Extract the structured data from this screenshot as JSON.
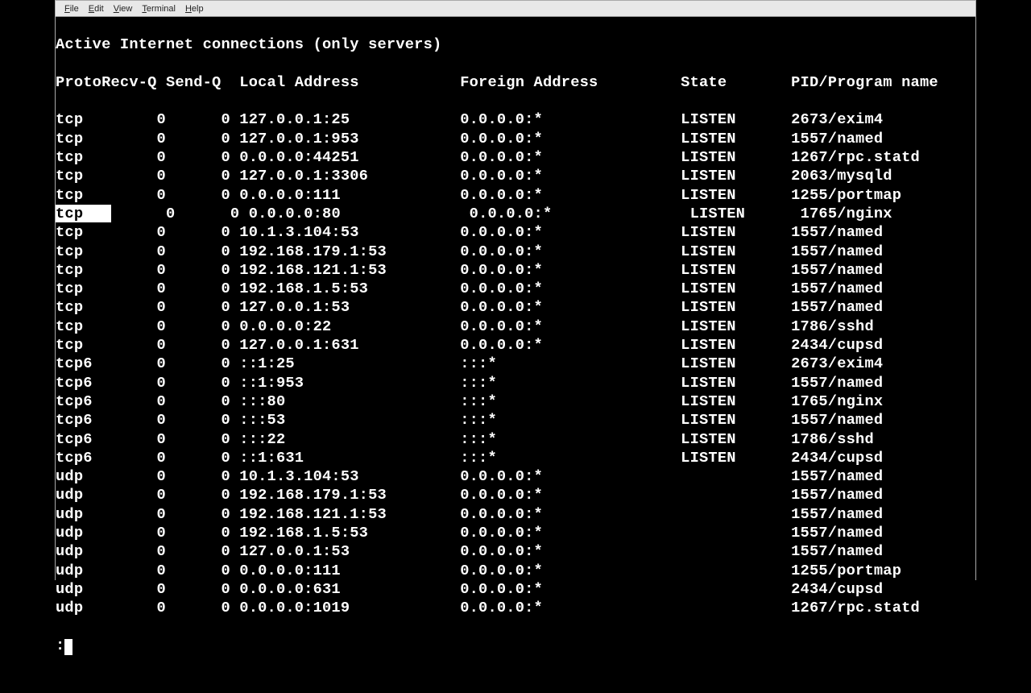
{
  "menu": {
    "file": "File",
    "edit": "Edit",
    "view": "View",
    "terminal": "Terminal",
    "help": "Help"
  },
  "title_line": "Active Internet connections (only servers)",
  "headers": {
    "proto": "Proto",
    "recvq": "Recv-Q",
    "sendq": "Send-Q",
    "local": "Local Address",
    "foreign": "Foreign Address",
    "state": "State",
    "pid": "PID/Program name"
  },
  "rows": [
    {
      "proto": "tcp",
      "recvq": "0",
      "sendq": "0",
      "local": "127.0.0.1:25",
      "foreign": "0.0.0.0:*",
      "state": "LISTEN",
      "pid": "2673/exim4",
      "hl": false
    },
    {
      "proto": "tcp",
      "recvq": "0",
      "sendq": "0",
      "local": "127.0.0.1:953",
      "foreign": "0.0.0.0:*",
      "state": "LISTEN",
      "pid": "1557/named",
      "hl": false
    },
    {
      "proto": "tcp",
      "recvq": "0",
      "sendq": "0",
      "local": "0.0.0.0:44251",
      "foreign": "0.0.0.0:*",
      "state": "LISTEN",
      "pid": "1267/rpc.statd",
      "hl": false
    },
    {
      "proto": "tcp",
      "recvq": "0",
      "sendq": "0",
      "local": "127.0.0.1:3306",
      "foreign": "0.0.0.0:*",
      "state": "LISTEN",
      "pid": "2063/mysqld",
      "hl": false
    },
    {
      "proto": "tcp",
      "recvq": "0",
      "sendq": "0",
      "local": "0.0.0.0:111",
      "foreign": "0.0.0.0:*",
      "state": "LISTEN",
      "pid": "1255/portmap",
      "hl": false
    },
    {
      "proto": "tcp",
      "recvq": "0",
      "sendq": "0",
      "local": "0.0.0.0:80",
      "foreign": "0.0.0.0:*",
      "state": "LISTEN",
      "pid": "1765/nginx",
      "hl": true
    },
    {
      "proto": "tcp",
      "recvq": "0",
      "sendq": "0",
      "local": "10.1.3.104:53",
      "foreign": "0.0.0.0:*",
      "state": "LISTEN",
      "pid": "1557/named",
      "hl": false
    },
    {
      "proto": "tcp",
      "recvq": "0",
      "sendq": "0",
      "local": "192.168.179.1:53",
      "foreign": "0.0.0.0:*",
      "state": "LISTEN",
      "pid": "1557/named",
      "hl": false
    },
    {
      "proto": "tcp",
      "recvq": "0",
      "sendq": "0",
      "local": "192.168.121.1:53",
      "foreign": "0.0.0.0:*",
      "state": "LISTEN",
      "pid": "1557/named",
      "hl": false
    },
    {
      "proto": "tcp",
      "recvq": "0",
      "sendq": "0",
      "local": "192.168.1.5:53",
      "foreign": "0.0.0.0:*",
      "state": "LISTEN",
      "pid": "1557/named",
      "hl": false
    },
    {
      "proto": "tcp",
      "recvq": "0",
      "sendq": "0",
      "local": "127.0.0.1:53",
      "foreign": "0.0.0.0:*",
      "state": "LISTEN",
      "pid": "1557/named",
      "hl": false
    },
    {
      "proto": "tcp",
      "recvq": "0",
      "sendq": "0",
      "local": "0.0.0.0:22",
      "foreign": "0.0.0.0:*",
      "state": "LISTEN",
      "pid": "1786/sshd",
      "hl": false
    },
    {
      "proto": "tcp",
      "recvq": "0",
      "sendq": "0",
      "local": "127.0.0.1:631",
      "foreign": "0.0.0.0:*",
      "state": "LISTEN",
      "pid": "2434/cupsd",
      "hl": false
    },
    {
      "proto": "tcp6",
      "recvq": "0",
      "sendq": "0",
      "local": "::1:25",
      "foreign": ":::*",
      "state": "LISTEN",
      "pid": "2673/exim4",
      "hl": false
    },
    {
      "proto": "tcp6",
      "recvq": "0",
      "sendq": "0",
      "local": "::1:953",
      "foreign": ":::*",
      "state": "LISTEN",
      "pid": "1557/named",
      "hl": false
    },
    {
      "proto": "tcp6",
      "recvq": "0",
      "sendq": "0",
      "local": ":::80",
      "foreign": ":::*",
      "state": "LISTEN",
      "pid": "1765/nginx",
      "hl": false
    },
    {
      "proto": "tcp6",
      "recvq": "0",
      "sendq": "0",
      "local": ":::53",
      "foreign": ":::*",
      "state": "LISTEN",
      "pid": "1557/named",
      "hl": false
    },
    {
      "proto": "tcp6",
      "recvq": "0",
      "sendq": "0",
      "local": ":::22",
      "foreign": ":::*",
      "state": "LISTEN",
      "pid": "1786/sshd",
      "hl": false
    },
    {
      "proto": "tcp6",
      "recvq": "0",
      "sendq": "0",
      "local": "::1:631",
      "foreign": ":::*",
      "state": "LISTEN",
      "pid": "2434/cupsd",
      "hl": false
    },
    {
      "proto": "udp",
      "recvq": "0",
      "sendq": "0",
      "local": "10.1.3.104:53",
      "foreign": "0.0.0.0:*",
      "state": "",
      "pid": "1557/named",
      "hl": false
    },
    {
      "proto": "udp",
      "recvq": "0",
      "sendq": "0",
      "local": "192.168.179.1:53",
      "foreign": "0.0.0.0:*",
      "state": "",
      "pid": "1557/named",
      "hl": false
    },
    {
      "proto": "udp",
      "recvq": "0",
      "sendq": "0",
      "local": "192.168.121.1:53",
      "foreign": "0.0.0.0:*",
      "state": "",
      "pid": "1557/named",
      "hl": false
    },
    {
      "proto": "udp",
      "recvq": "0",
      "sendq": "0",
      "local": "192.168.1.5:53",
      "foreign": "0.0.0.0:*",
      "state": "",
      "pid": "1557/named",
      "hl": false
    },
    {
      "proto": "udp",
      "recvq": "0",
      "sendq": "0",
      "local": "127.0.0.1:53",
      "foreign": "0.0.0.0:*",
      "state": "",
      "pid": "1557/named",
      "hl": false
    },
    {
      "proto": "udp",
      "recvq": "0",
      "sendq": "0",
      "local": "0.0.0.0:111",
      "foreign": "0.0.0.0:*",
      "state": "",
      "pid": "1255/portmap",
      "hl": false
    },
    {
      "proto": "udp",
      "recvq": "0",
      "sendq": "0",
      "local": "0.0.0.0:631",
      "foreign": "0.0.0.0:*",
      "state": "",
      "pid": "2434/cupsd",
      "hl": false
    },
    {
      "proto": "udp",
      "recvq": "0",
      "sendq": "0",
      "local": "0.0.0.0:1019",
      "foreign": "0.0.0.0:*",
      "state": "",
      "pid": "1267/rpc.statd",
      "hl": false
    }
  ],
  "prompt": ":"
}
